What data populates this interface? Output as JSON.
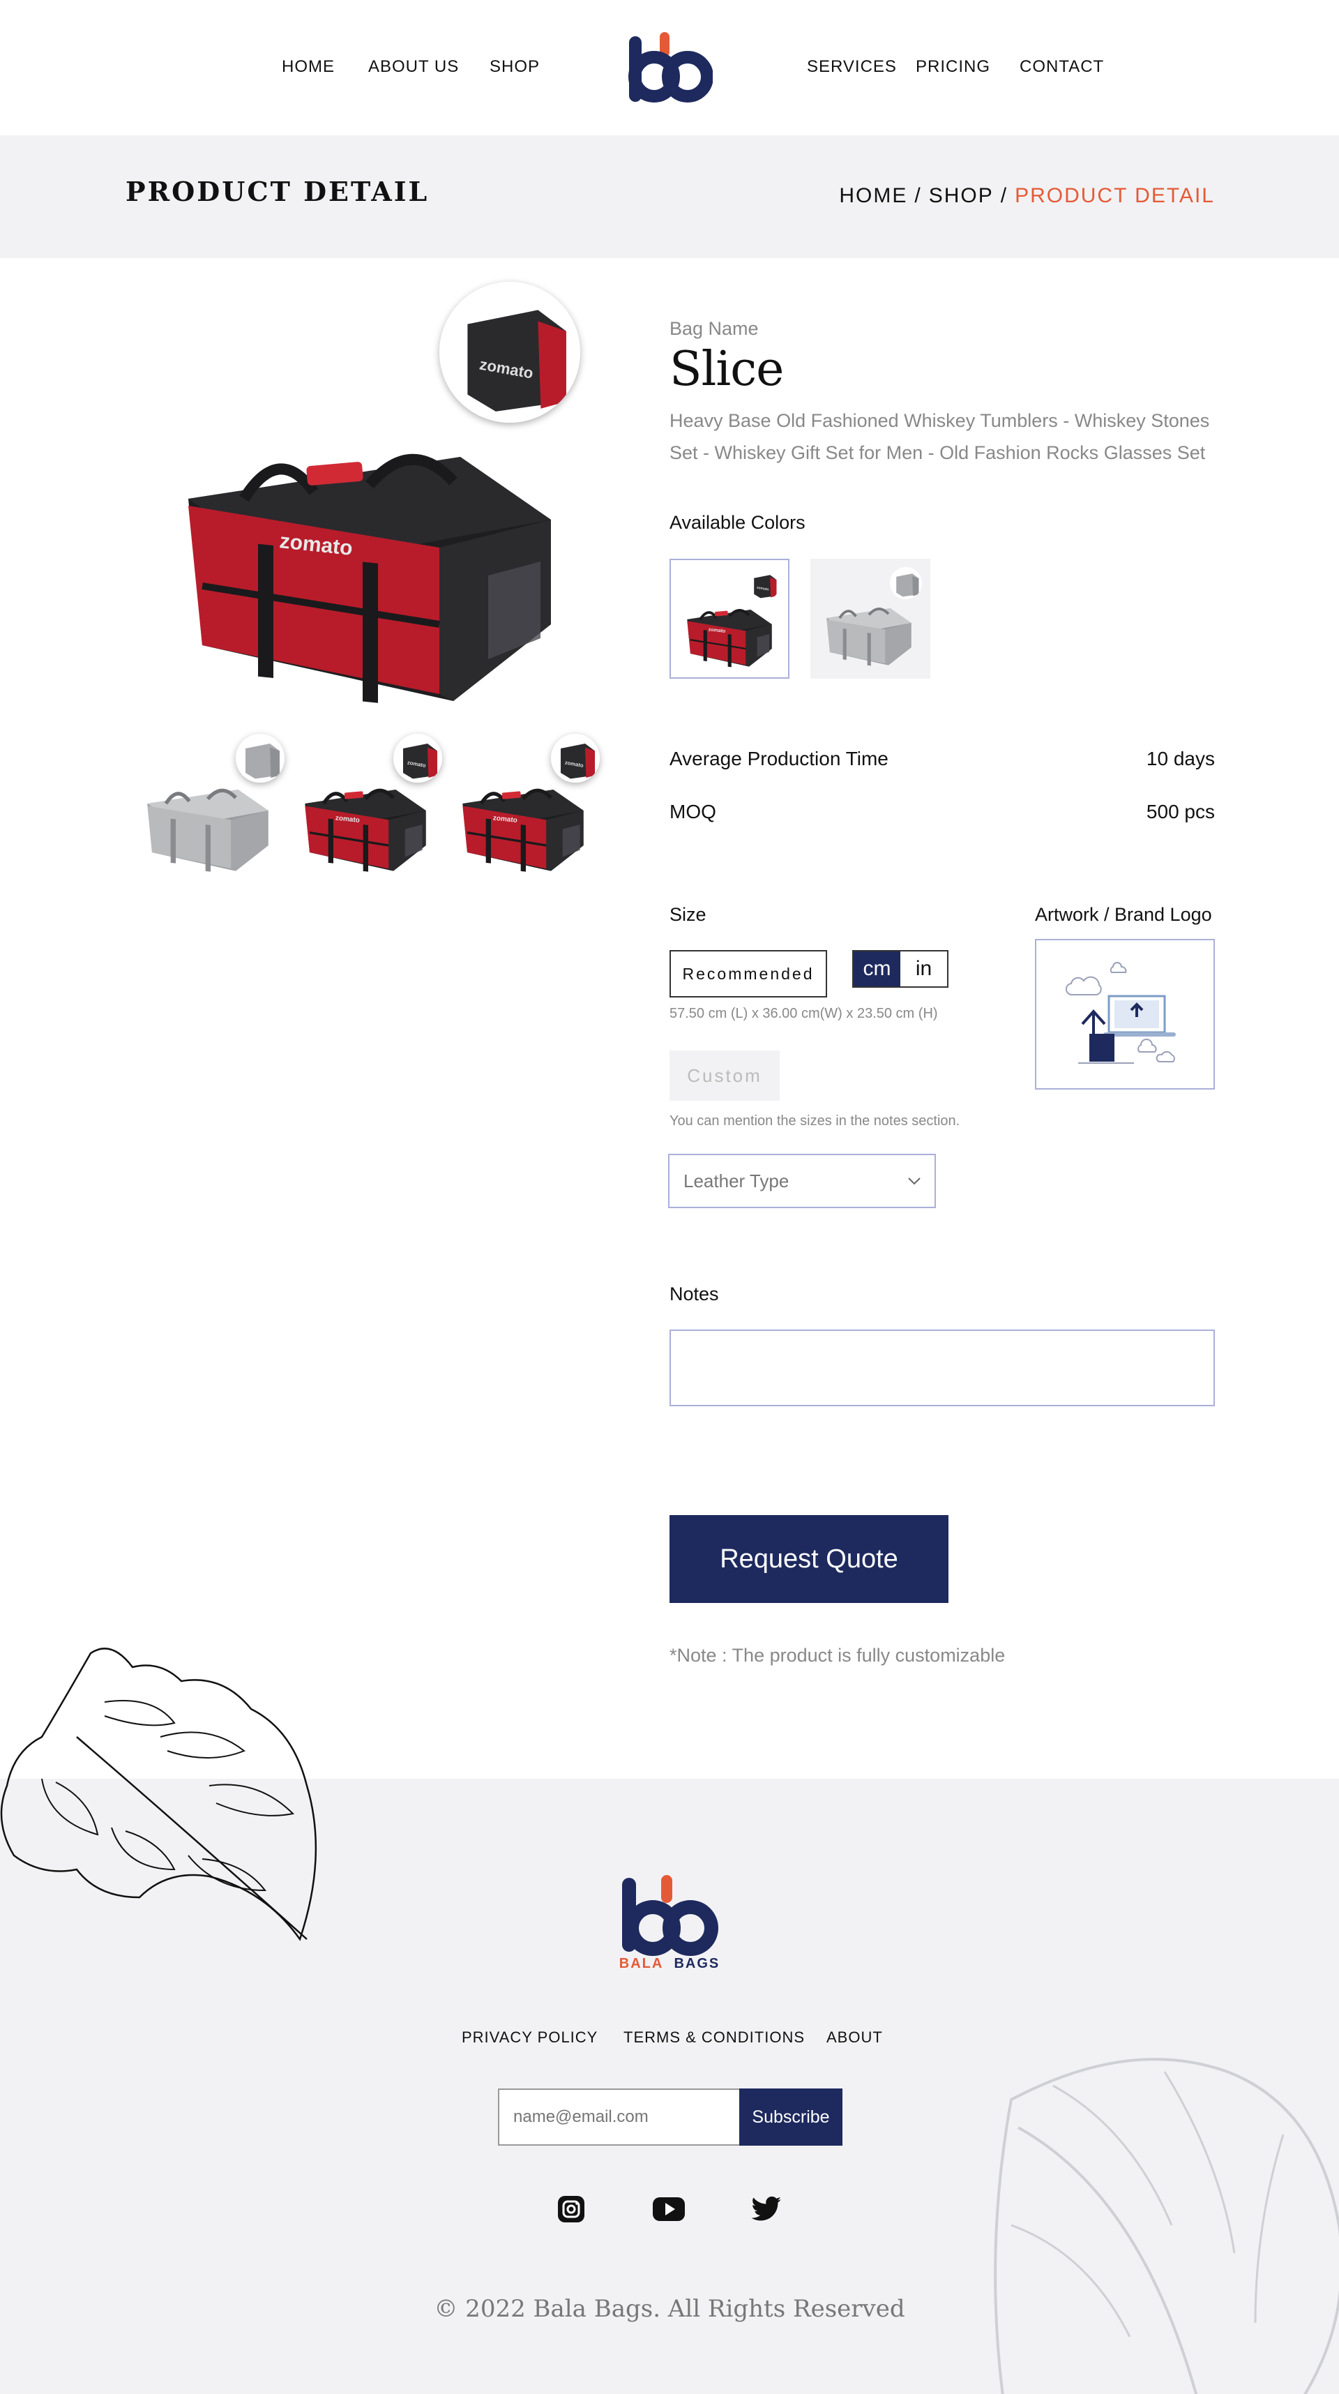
{
  "nav": {
    "home": "HOME",
    "about": "ABOUT US",
    "shop": "SHOP",
    "services": "SERVICES",
    "pricing": "PRICING",
    "contact": "CONTACT"
  },
  "title_bar": {
    "title": "PRODUCT DETAIL",
    "breadcrumb": [
      "HOME",
      "SHOP",
      "PRODUCT DETAIL"
    ],
    "separator": "/"
  },
  "product": {
    "bag_label": "Bag Name",
    "name": "Slice",
    "description": "Heavy Base Old Fashioned Whiskey Tumblers - Whiskey Stones Set - Whiskey Gift Set for Men - Old Fashion Rocks Glasses Set",
    "brand_on_bag": "zomato",
    "available_colors_label": "Available Colors",
    "colors": [
      {
        "name": "red",
        "hex": "#b81c2a",
        "selected": true
      },
      {
        "name": "grey",
        "hex": "#b9babc",
        "selected": false
      }
    ],
    "thumbnails": [
      "grey",
      "red",
      "red"
    ],
    "avg_production_label": "Average Production Time",
    "avg_production_value": "10 days",
    "moq_label": "MOQ",
    "moq_value": "500 pcs",
    "size_label": "Size",
    "recommended_label": "Recommended",
    "unit_cm": "cm",
    "unit_in": "in",
    "size_dims": "57.50 cm (L) x 36.00 cm(W) x 23.50 cm (H)",
    "custom_label": "Custom",
    "custom_hint": "You can mention the sizes in the notes section.",
    "leather_placeholder": "Leather Type",
    "artwork_label": "Artwork / Brand Logo",
    "notes_label": "Notes",
    "quote_button": "Request Quote",
    "note_text": "*Note : The product is fully customizable"
  },
  "footer": {
    "logo_word1": "BALA",
    "logo_word2": "BAGS",
    "links": [
      "PRIVACY POLICY",
      "TERMS & CONDITIONS",
      "ABOUT"
    ],
    "email_placeholder": "name@email.com",
    "subscribe_label": "Subscribe",
    "social": [
      "instagram-icon",
      "youtube-icon",
      "twitter-icon"
    ],
    "copyright": "© 2022 Bala Bags. All Rights Reserved"
  },
  "colors": {
    "brand_navy": "#1e2a5e",
    "accent_orange": "#e55a36",
    "light_bg": "#f2f2f4"
  }
}
